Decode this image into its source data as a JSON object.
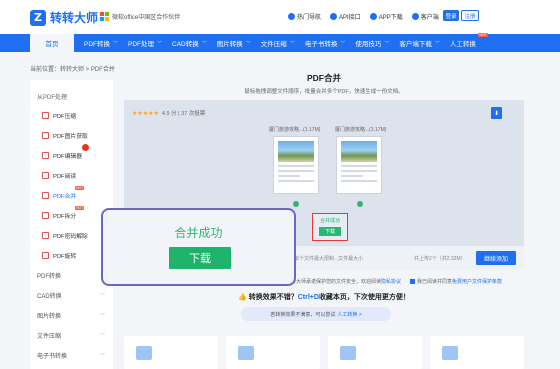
{
  "header": {
    "logo_icon": "Z",
    "logo_text": "转转大师",
    "partner_text": "微软office中国区合作伙伴",
    "links": [
      {
        "icon": "fire-icon",
        "label": "热门导航"
      },
      {
        "icon": "api-icon",
        "label": "API接口"
      },
      {
        "icon": "app-icon",
        "label": "APP下载"
      },
      {
        "icon": "user-icon",
        "label": "客户端"
      }
    ],
    "login_label": "登录",
    "register_label": "注册"
  },
  "nav": {
    "home_label": "首页",
    "items": [
      {
        "label": "PDF转换",
        "chev": "﹀"
      },
      {
        "label": "PDF处理",
        "chev": "﹀"
      },
      {
        "label": "CAD转换",
        "chev": "﹀"
      },
      {
        "label": "图片转换",
        "chev": "﹀"
      },
      {
        "label": "文件压缩",
        "chev": "﹀"
      },
      {
        "label": "电子书转换",
        "chev": "﹀"
      },
      {
        "label": "使用技巧",
        "chev": "﹀"
      },
      {
        "label": "客户端下载",
        "chev": "﹀"
      },
      {
        "label": "人工转换",
        "chev": ""
      }
    ],
    "hot_badge": "HOT"
  },
  "breadcrumb": "当前位置：转转大师 > PDF合并",
  "sidebar": {
    "heading": "从PDF处理",
    "items": [
      {
        "label": "PDF压缩"
      },
      {
        "label": "PDF图片获取"
      },
      {
        "label": "PDF编辑器"
      },
      {
        "label": "PDF阅读"
      },
      {
        "label": "PDF合并"
      },
      {
        "label": "PDF拆分"
      },
      {
        "label": "PDF密码解除"
      },
      {
        "label": "PDF旋转"
      }
    ],
    "hot_badge": "HOT",
    "categories": [
      {
        "label": "PDF转换",
        "chev": ""
      },
      {
        "label": "CAD转换",
        "chev": "﹀"
      },
      {
        "label": "图片转换",
        "chev": "﹀"
      },
      {
        "label": "文件压缩",
        "chev": "﹀"
      },
      {
        "label": "电子书转换",
        "chev": "﹀"
      }
    ]
  },
  "main": {
    "title": "PDF合并",
    "subtitle": "鼠标拖拽调整文件顺序，批量合并多个PDF，快速生成一份文档。",
    "rating_stars": "★★★★★",
    "rating_text": "4.9 分 | 37 次投票",
    "download_icon": "⬇",
    "files": [
      {
        "name": "厦门旅游攻略...(1.17M)"
      },
      {
        "name": "厦门旅游攻略...(1.17M)"
      }
    ],
    "result_label": "合并成功",
    "result_button": "下载",
    "size_note": "单个文件最大限制...文件最大小",
    "total_note": "共上传2个（共2.32M）",
    "continue_button": "继续添加",
    "notice_left": "转转大师承诺保护您的文件安全，欢迎阅读",
    "notice_left_link": "隐私协议",
    "notice_right": "我已阅读并同意",
    "notice_right_link": "免费用户文件保护条款",
    "bookmark_prefix": "转换效果不错？",
    "bookmark_ctrl": "Ctrl+D",
    "bookmark_suffix": "收藏本页，下次使用更方便！",
    "suggest_text": "若转换效果不满意，可以尝试",
    "suggest_link": "人工转换 >"
  },
  "overlay": {
    "title": "合并成功",
    "download_button": "下载"
  },
  "colors": {
    "brand": "#1e6ff1",
    "success": "#2bb673",
    "danger": "#e53935"
  }
}
